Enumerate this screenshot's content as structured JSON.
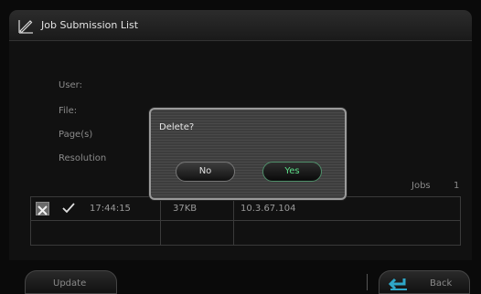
{
  "header": {
    "title": "Job Submission List",
    "icon": "pen-edit-icon"
  },
  "info": {
    "labels": [
      "User:",
      "File:",
      "Page(s)",
      "Resolution"
    ]
  },
  "jobs": {
    "label": "Jobs",
    "count": "1"
  },
  "table": {
    "rows": [
      {
        "time": "17:44:15",
        "size": "37KB",
        "ip": "10.3.67.104"
      }
    ]
  },
  "dialog": {
    "message": "Delete?",
    "no_label": "No",
    "yes_label": "Yes"
  },
  "footer": {
    "update_label": "Update",
    "back_label": "Back"
  },
  "colors": {
    "accent_green": "#5de08a",
    "back_icon": "#2fa7c8"
  }
}
